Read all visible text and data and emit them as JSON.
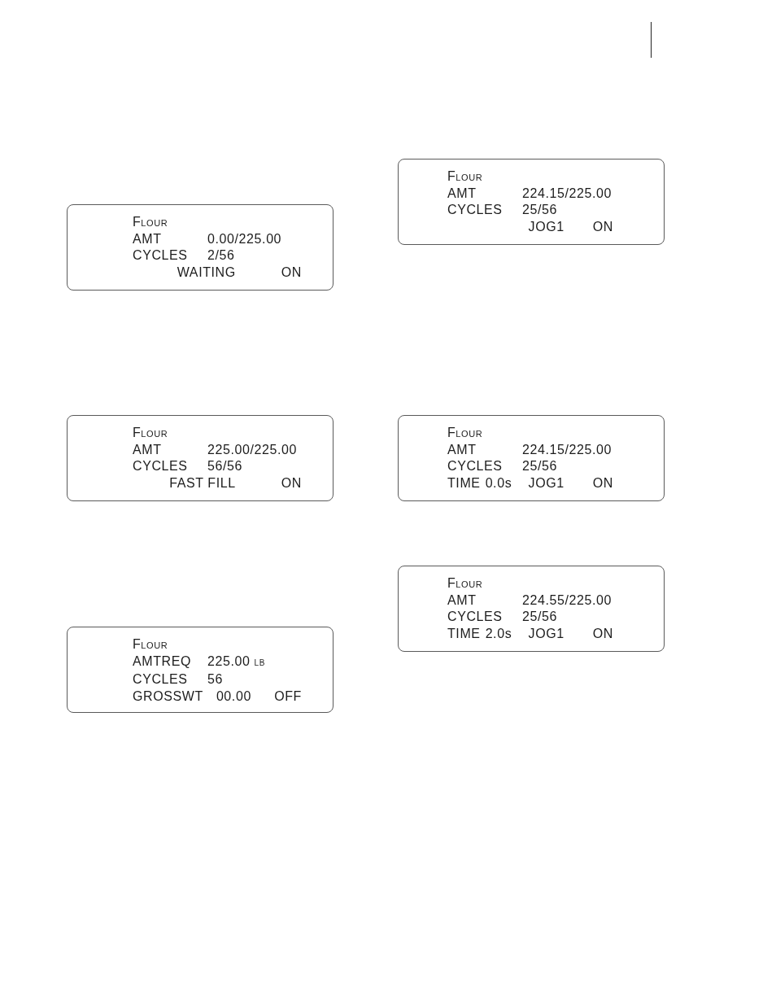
{
  "columns": [
    {
      "displays": [
        {
          "title": "Flour",
          "rows": [
            {
              "label": "AMT",
              "value": "0.00/225.00"
            },
            {
              "label": "CYCLES",
              "value": "2/56"
            }
          ],
          "status": {
            "mode": "WAITING",
            "reading": "ON"
          }
        },
        {
          "title": "Flour",
          "rows": [
            {
              "label": "AMT",
              "value": "225.00/225.00"
            },
            {
              "label": "CYCLES",
              "value": "56/56"
            }
          ],
          "status": {
            "mode": "FAST FILL",
            "reading": "ON"
          }
        },
        {
          "title": "Flour",
          "rows": [
            {
              "label": "AMTREQ",
              "value": "225.00",
              "unit": "LB"
            },
            {
              "label": "CYCLES",
              "value": "56"
            }
          ],
          "status": {
            "label": "GROSSWT",
            "value": "00.00",
            "reading": "OFF"
          }
        }
      ]
    },
    {
      "displays": [
        {
          "title": "Flour",
          "rows": [
            {
              "label": "AMT",
              "value": "224.15/225.00"
            },
            {
              "label": "CYCLES",
              "value": "25/56"
            }
          ],
          "status": {
            "mode": "JOG1",
            "reading": "ON"
          }
        },
        {
          "title": "Flour",
          "rows": [
            {
              "label": "AMT",
              "value": "224.15/225.00"
            },
            {
              "label": "CYCLES",
              "value": "25/56"
            }
          ],
          "status": {
            "label": "TIME",
            "value": "0.0s",
            "mode": "JOG1",
            "reading": "ON"
          }
        },
        {
          "title": "Flour",
          "rows": [
            {
              "label": "AMT",
              "value": "224.55/225.00"
            },
            {
              "label": "CYCLES",
              "value": "25/56"
            }
          ],
          "status": {
            "label": "TIME",
            "value": "2.0s",
            "mode": "JOG1",
            "reading": "ON"
          }
        }
      ]
    }
  ]
}
